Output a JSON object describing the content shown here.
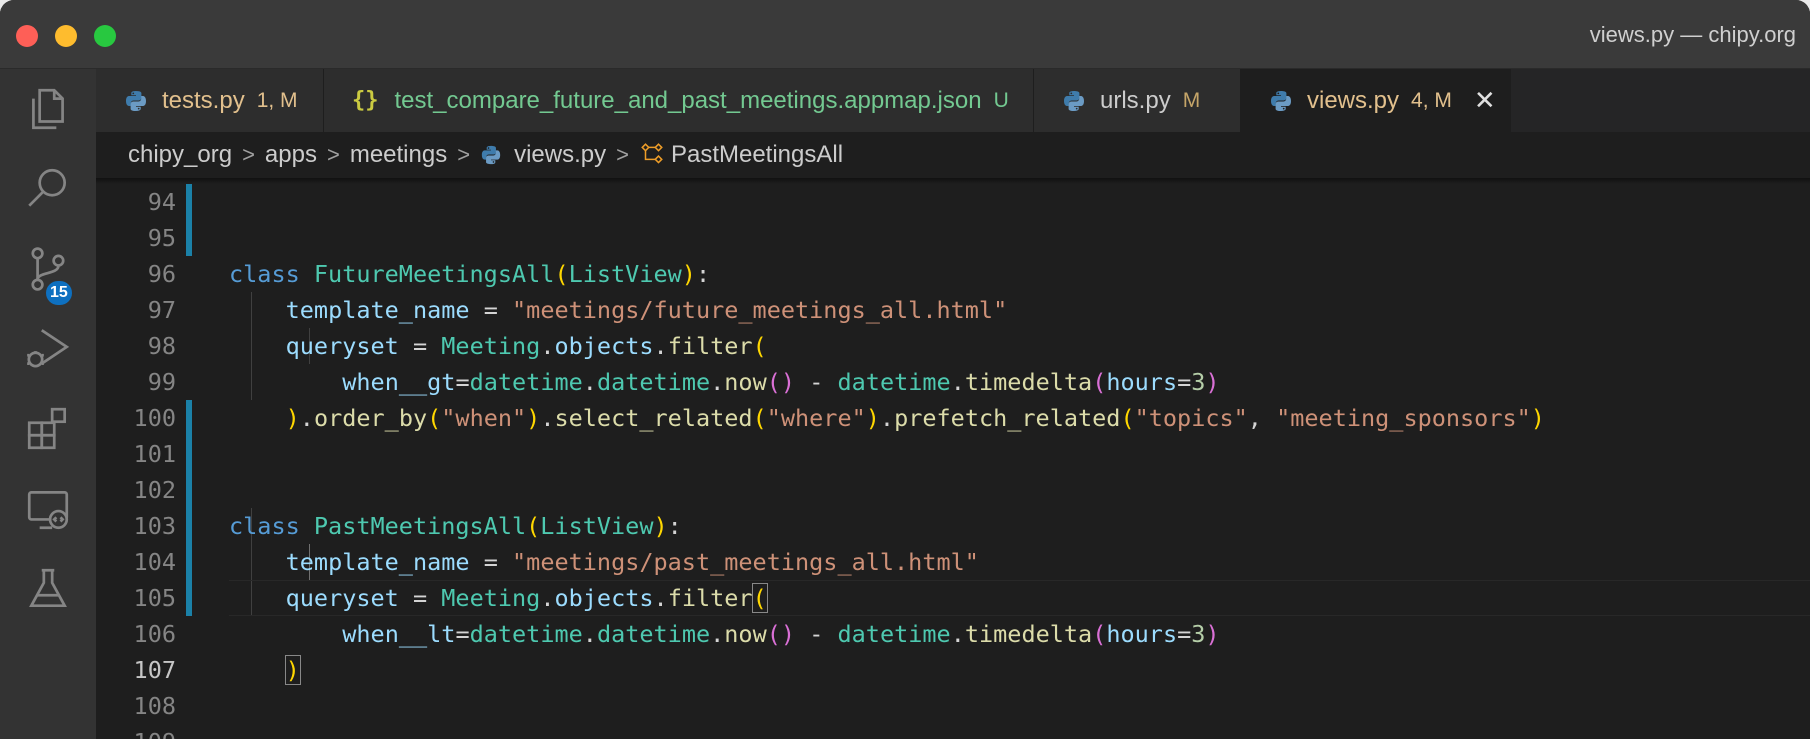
{
  "window": {
    "title": "views.py — chipy.org"
  },
  "activity": {
    "items": [
      {
        "name": "explorer",
        "icon": "files-icon"
      },
      {
        "name": "search",
        "icon": "search-icon"
      },
      {
        "name": "source-control",
        "icon": "source-control-icon",
        "badge": "15"
      },
      {
        "name": "run-debug",
        "icon": "run-debug-icon"
      },
      {
        "name": "extensions",
        "icon": "extensions-icon"
      },
      {
        "name": "remote-explorer",
        "icon": "remote-explorer-icon"
      },
      {
        "name": "testing",
        "icon": "beaker-icon"
      }
    ]
  },
  "tabs": [
    {
      "label": "tests.py",
      "status": "1, M",
      "icon": "python-icon"
    },
    {
      "label": "test_compare_future_and_past_meetings.appmap.json",
      "status": "U",
      "icon": "json-icon",
      "icon_text": "{}"
    },
    {
      "label": "urls.py",
      "status": "M",
      "icon": "python-icon"
    },
    {
      "label": "views.py",
      "status": "4, M",
      "icon": "python-icon",
      "active": true,
      "close": "✕"
    }
  ],
  "breadcrumbs": {
    "items": [
      "chipy_org",
      "apps",
      "meetings",
      "views.py",
      "PastMeetingsAll"
    ],
    "separator": ">"
  },
  "editor": {
    "current_line": "107",
    "lines": [
      {
        "num": "94",
        "text": ""
      },
      {
        "num": "95",
        "text": ""
      },
      {
        "num": "96",
        "text": "class FutureMeetingsAll(ListView):"
      },
      {
        "num": "97",
        "text": "    template_name = \"meetings/future_meetings_all.html\""
      },
      {
        "num": "98",
        "text": "    queryset = Meeting.objects.filter("
      },
      {
        "num": "99",
        "text": "        when__gt=datetime.datetime.now() - datetime.timedelta(hours=3)"
      },
      {
        "num": "100",
        "text": "    ).order_by(\"when\").select_related(\"where\").prefetch_related(\"topics\", \"meeting_sponsors\")"
      },
      {
        "num": "101",
        "text": ""
      },
      {
        "num": "102",
        "text": ""
      },
      {
        "num": "103",
        "text": "class PastMeetingsAll(ListView):"
      },
      {
        "num": "104",
        "text": "    template_name = \"meetings/past_meetings_all.html\""
      },
      {
        "num": "105",
        "text": "    queryset = Meeting.objects.filter("
      },
      {
        "num": "106",
        "text": "        when__lt=datetime.datetime.now() - datetime.timedelta(hours=3)"
      },
      {
        "num": "107",
        "text": "    )"
      },
      {
        "num": "108",
        "text": ""
      },
      {
        "num": "109",
        "text": ""
      }
    ]
  },
  "colors": {
    "accent_gutter": "#1b81a8",
    "badge": "#0e70c0",
    "modified": "#e2c08d",
    "untracked": "#73c991"
  }
}
